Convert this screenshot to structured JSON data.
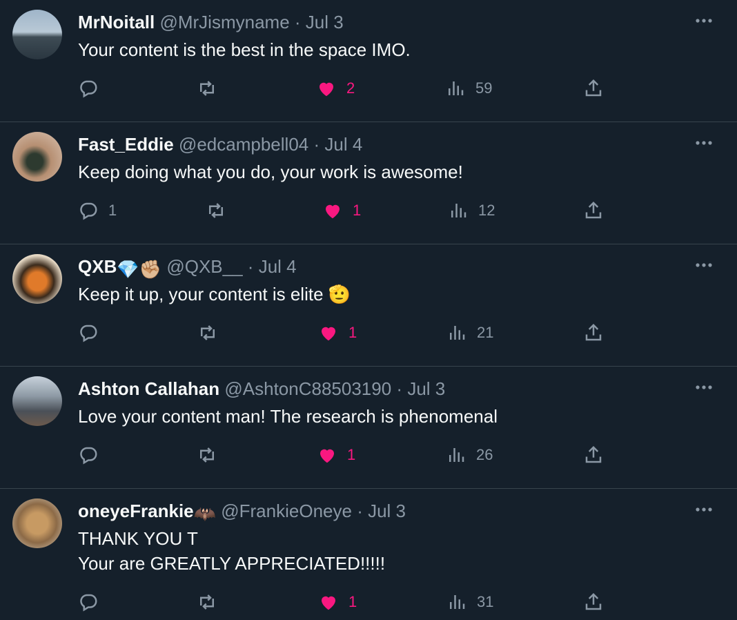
{
  "tweets": [
    {
      "name": "MrNoitall",
      "handle": "@MrJismyname",
      "date": "Jul 3",
      "text_lines": [
        "Your content is the best in the space IMO."
      ],
      "replies": "",
      "likes": "2",
      "views": "59"
    },
    {
      "name": "Fast_Eddie",
      "handle": "@edcampbell04",
      "date": "Jul 4",
      "text_lines": [
        "Keep doing what you do, your work is awesome!"
      ],
      "replies": "1",
      "likes": "1",
      "views": "12"
    },
    {
      "name": "QXB",
      "name_emoji": "💎✊🏼",
      "handle": "@QXB__",
      "date": "Jul 4",
      "text_lines": [
        "Keep it up, your content is elite 🫡"
      ],
      "replies": "",
      "likes": "1",
      "views": "21"
    },
    {
      "name": "Ashton Callahan",
      "handle": "@AshtonC88503190",
      "date": "Jul 3",
      "text_lines": [
        "Love your content man! The research is phenomenal"
      ],
      "replies": "",
      "likes": "1",
      "views": "26"
    },
    {
      "name": "oneyeFrankie",
      "name_emoji": "🦇",
      "handle": "@FrankieOneye",
      "date": "Jul 3",
      "text_lines": [
        "THANK YOU T",
        "Your are GREATLY APPRECIATED!!!!!"
      ],
      "replies": "",
      "likes": "1",
      "views": "31"
    }
  ],
  "colors": {
    "background": "#15202b",
    "muted": "#8b98a5",
    "like": "#f91880",
    "divider": "#38444d"
  }
}
